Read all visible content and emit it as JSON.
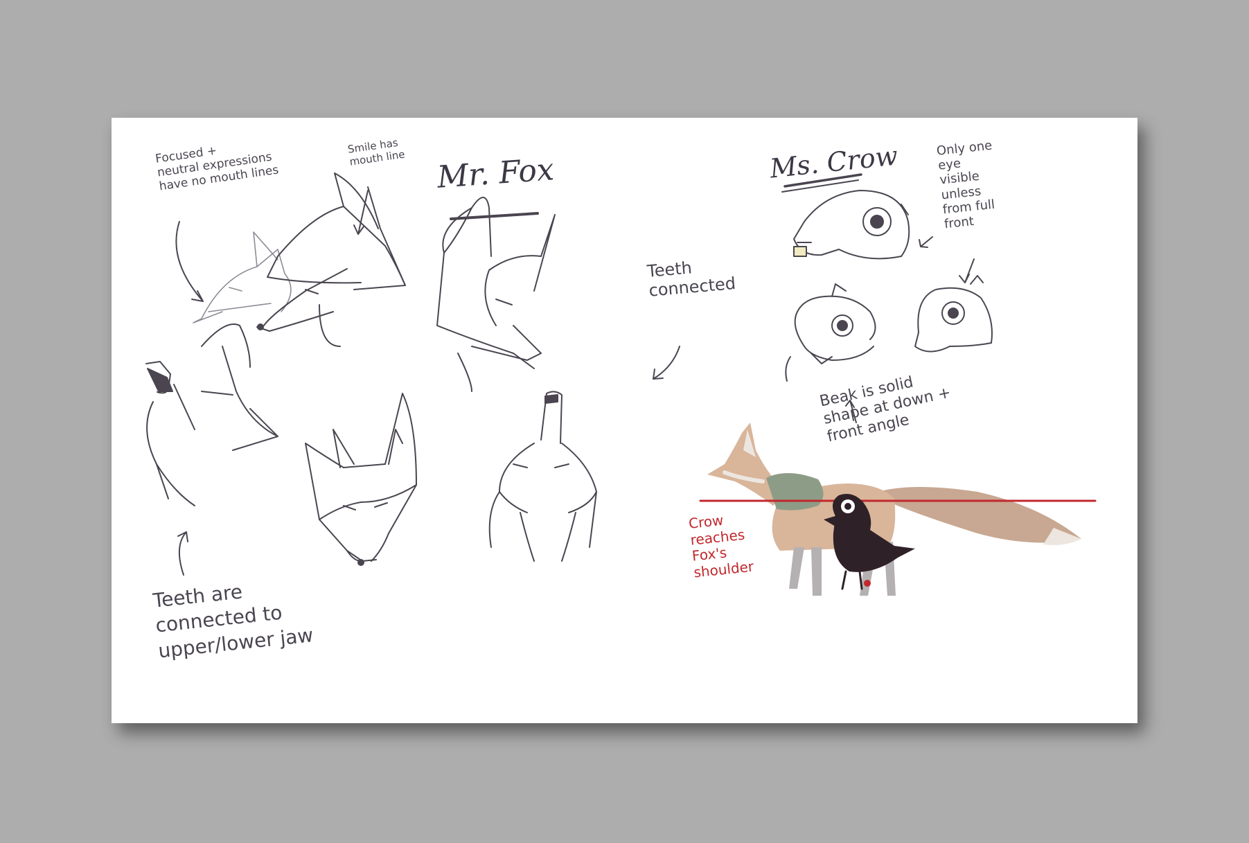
{
  "fox_section": {
    "title": "Mr. Fox",
    "note_expressions": "Focused +\nneutral expressions\nhave no mouth lines",
    "note_smile": "Smile has\nmouth line",
    "note_teeth_connected": "Teeth\nconnected",
    "note_teeth_jaw": "Teeth are\nconnected to\nupper/lower jaw"
  },
  "crow_section": {
    "title": "Ms. Crow",
    "note_one_eye": "Only one\neye\nvisible\nunless\nfrom full\nfront",
    "note_beak": "Beak is solid\nshape at down +\nfront angle"
  },
  "scale_section": {
    "note_height": "Crow\nreaches\nFox's\nshoulder"
  },
  "colors": {
    "background": "#adadad",
    "paper": "#ffffff",
    "pencil": "#4a4550",
    "red_line": "#c1282d",
    "fox_fur": "#d9b59a",
    "fox_tail_tip": "#ede6e0",
    "fox_scarf": "#8d9c86",
    "crow_body": "#2f2128"
  }
}
